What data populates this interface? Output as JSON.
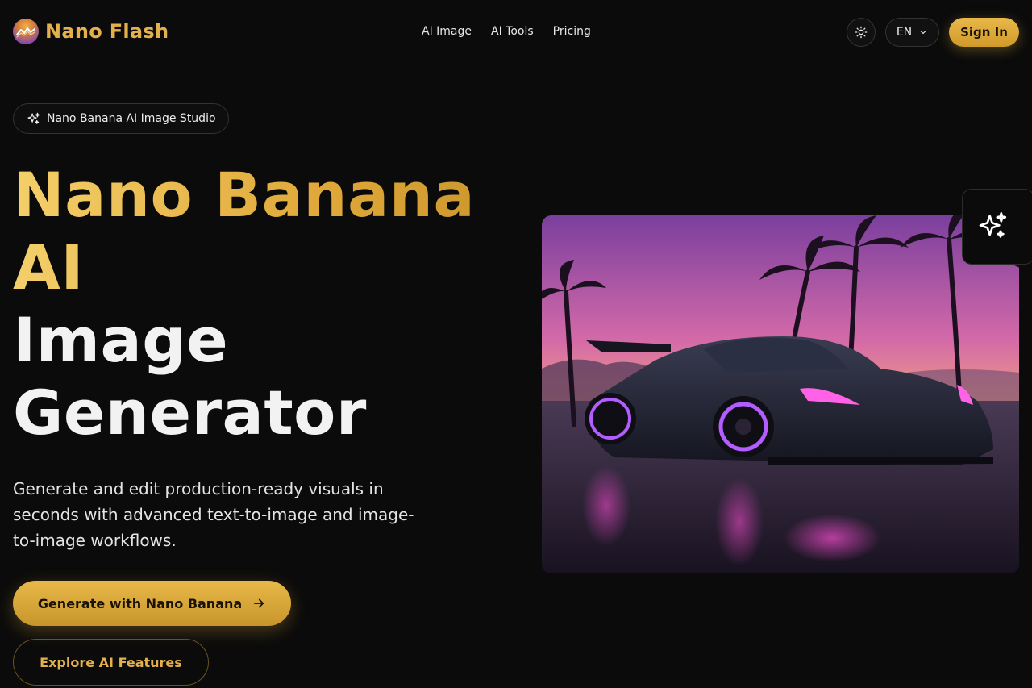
{
  "header": {
    "brand_name": "Nano Flash",
    "nav": [
      "AI Image",
      "AI Tools",
      "Pricing"
    ],
    "language": "EN",
    "sign_in_label": "Sign In"
  },
  "hero": {
    "badge_text": "Nano Banana AI Image Studio",
    "title_lines": [
      "Nano Banana",
      "AI",
      "Image",
      "Generator"
    ],
    "description": "Generate and edit production-ready visuals in seconds with advanced text-to-image and image-to-image workflows.",
    "primary_cta": "Generate with Nano Banana",
    "secondary_cta": "Explore AI Features"
  },
  "icons": {
    "logo": "nano-flash-logo",
    "theme_toggle": "sun-icon",
    "language_chevron": "chevron-down-icon",
    "badge_icon": "sparkles-icon",
    "cta_arrow": "arrow-right-icon",
    "floating_icon": "sparkles-icon"
  },
  "colors": {
    "background": "#0b0b0b",
    "accent_gold": "#e3b04b",
    "text": "#f2f2f2"
  }
}
